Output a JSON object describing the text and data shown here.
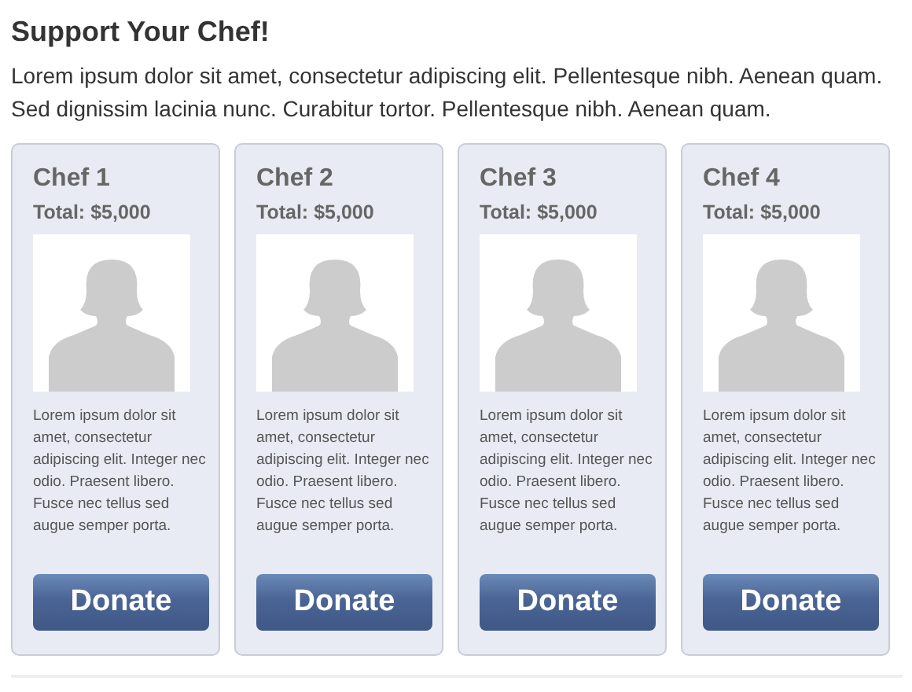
{
  "heading": "Support Your Chef!",
  "intro": "Lorem ipsum dolor sit amet, consectetur adipiscing elit. Pellentesque nibh. Aenean quam. Sed dignissim lacinia nunc. Curabitur tortor. Pellentesque nibh. Aenean quam.",
  "chefs": [
    {
      "name": "Chef 1",
      "total": "Total: $5,000",
      "description": "Lorem ipsum dolor sit amet, consectetur adipiscing elit. Integer nec odio. Praesent libero. Fusce nec tellus sed augue semper porta.",
      "button": "Donate"
    },
    {
      "name": "Chef 2",
      "total": "Total: $5,000",
      "description": "Lorem ipsum dolor sit amet, consectetur adipiscing elit. Integer nec odio. Praesent libero. Fusce nec tellus sed augue semper porta.",
      "button": "Donate"
    },
    {
      "name": "Chef 3",
      "total": "Total: $5,000",
      "description": "Lorem ipsum dolor sit amet, consectetur adipiscing elit. Integer nec odio. Praesent libero. Fusce nec tellus sed augue semper porta.",
      "button": "Donate"
    },
    {
      "name": "Chef 4",
      "total": "Total: $5,000",
      "description": "Lorem ipsum dolor sit amet, consectetur adipiscing elit. Integer nec odio. Praesent libero. Fusce nec tellus sed augue semper porta.",
      "button": "Donate"
    }
  ]
}
